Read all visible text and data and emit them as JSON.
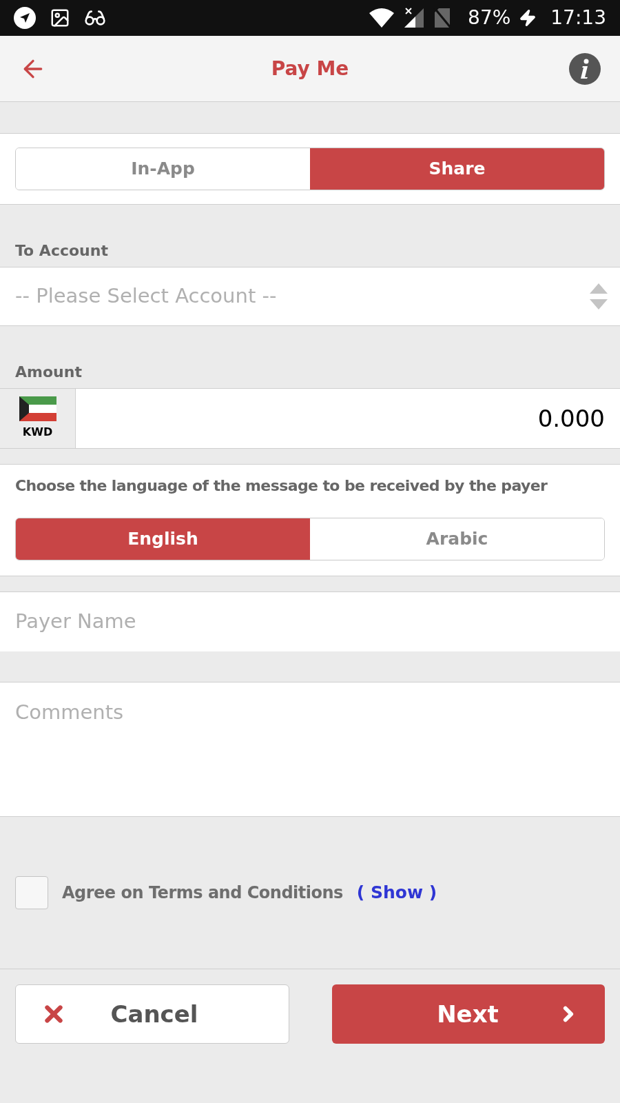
{
  "status_bar": {
    "battery": "87%",
    "time": "17:13"
  },
  "header": {
    "title": "Pay Me"
  },
  "mode_tabs": [
    {
      "label": "In-App",
      "selected": false
    },
    {
      "label": "Share",
      "selected": true
    }
  ],
  "to_account": {
    "label": "To Account",
    "placeholder": "-- Please Select Account --"
  },
  "amount": {
    "label": "Amount",
    "currency": "KWD",
    "value": "0.000"
  },
  "language": {
    "prompt": "Choose the language of the message to be received by the payer",
    "options": [
      {
        "label": "English",
        "selected": true
      },
      {
        "label": "Arabic",
        "selected": false
      }
    ]
  },
  "payer_name": {
    "placeholder": "Payer Name"
  },
  "comments": {
    "placeholder": "Comments"
  },
  "terms": {
    "label": "Agree on Terms and Conditions",
    "link": "( Show )",
    "checked": false
  },
  "buttons": {
    "cancel": "Cancel",
    "next": "Next"
  }
}
